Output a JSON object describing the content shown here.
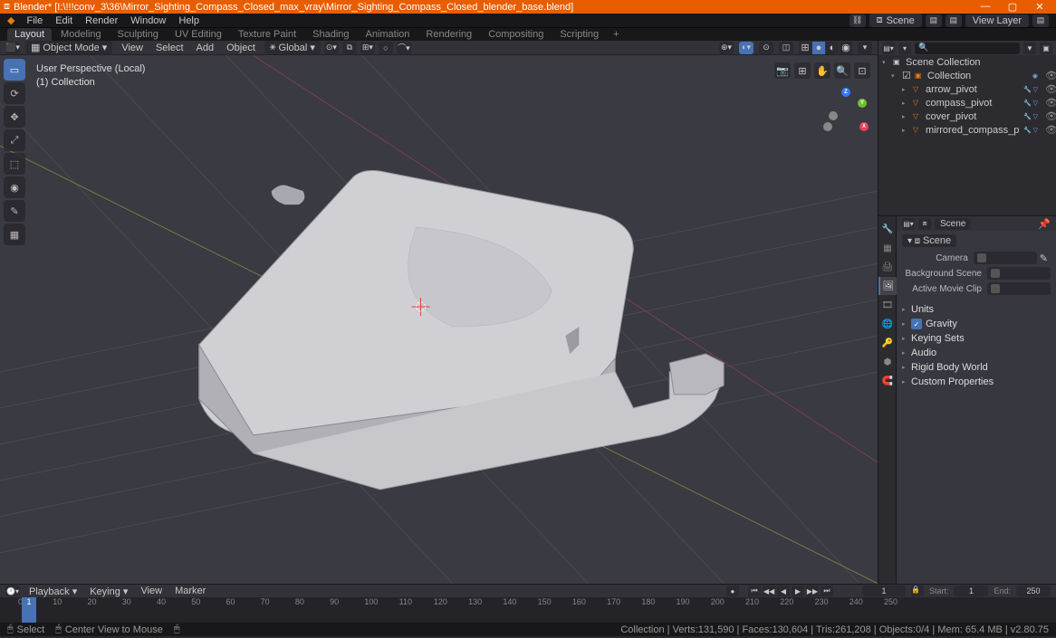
{
  "titlebar": {
    "icon": "⧈",
    "title": "Blender* [I:\\!!!conv_3\\36\\Mirror_Sighting_Compass_Closed_max_vray\\Mirror_Sighting_Compass_Closed_blender_base.blend]",
    "min": "—",
    "max": "▢",
    "close": "✕"
  },
  "menubar": {
    "items": [
      "File",
      "Edit",
      "Render",
      "Window",
      "Help"
    ],
    "scene_icon": "⧈",
    "scene": "Scene",
    "viewlayer_icon": "▤",
    "viewlayer": "View Layer"
  },
  "workspaces": [
    "Layout",
    "Modeling",
    "Sculpting",
    "UV Editing",
    "Texture Paint",
    "Shading",
    "Animation",
    "Rendering",
    "Compositing",
    "Scripting"
  ],
  "active_workspace": 0,
  "viewport": {
    "mode": "Object Mode",
    "menus": [
      "View",
      "Select",
      "Add",
      "Object"
    ],
    "orientation": "Global",
    "info1": "User Perspective (Local)",
    "info2": "(1) Collection"
  },
  "tools": [
    "▭",
    "⟳",
    "✥",
    "⤢",
    "⬚",
    "◉",
    "✎",
    "▦"
  ],
  "outliner": {
    "root": "Scene Collection",
    "collection": "Collection",
    "items": [
      "arrow_pivot",
      "compass_pivot",
      "cover_pivot",
      "mirrored_compass_pivot"
    ]
  },
  "props": {
    "scene": "Scene",
    "tabs": [
      "🔧",
      "▦",
      "🖨",
      "🖼",
      "🎞",
      "🌐",
      "🔑",
      "⬢",
      "🧲"
    ],
    "crumb": "Scene",
    "fields": {
      "camera": "Camera",
      "bgscene": "Background Scene",
      "clip": "Active Movie Clip"
    },
    "sections": [
      "Units",
      "Gravity",
      "Keying Sets",
      "Audio",
      "Rigid Body World",
      "Custom Properties"
    ],
    "gravity_checked": true
  },
  "timeline": {
    "menus": [
      "Playback",
      "Keying",
      "View",
      "Marker"
    ],
    "current": "1",
    "start_label": "Start:",
    "start": "1",
    "end_label": "End:",
    "end": "250",
    "ticks": [
      0,
      10,
      20,
      30,
      40,
      50,
      60,
      70,
      80,
      90,
      100,
      110,
      120,
      130,
      140,
      150,
      160,
      170,
      180,
      190,
      200,
      210,
      220,
      230,
      240,
      250
    ],
    "marker": "1"
  },
  "statusbar": {
    "left1": "Select",
    "left2": "Center View to Mouse",
    "stats": "Collection | Verts:131,590 | Faces:130,604 | Tris:261,208 | Objects:0/4 | Mem: 65.4 MB | v2.80.75"
  }
}
